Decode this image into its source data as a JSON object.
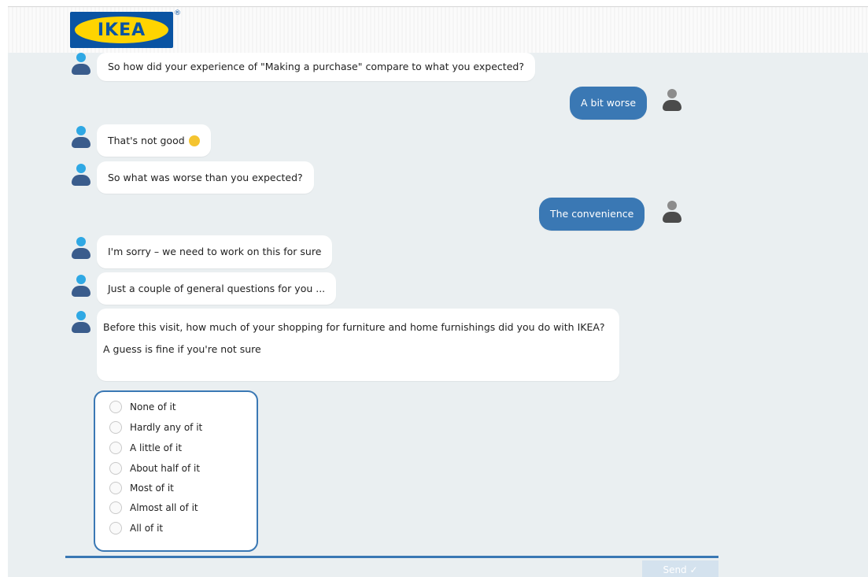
{
  "header": {
    "logo_text": "IKEA",
    "logo_mark": "®"
  },
  "messages": [
    {
      "from": "bot",
      "text": "So how did your experience of \"Making a purchase\" compare to what you expected?"
    },
    {
      "from": "user",
      "text": "A bit worse"
    },
    {
      "from": "bot",
      "text": "That's not good",
      "emoji": "grimacing-face-icon"
    },
    {
      "from": "bot",
      "text": "So what was worse than you expected?"
    },
    {
      "from": "user",
      "text": "The convenience"
    },
    {
      "from": "bot",
      "text": "I'm sorry – we need to work on this for sure"
    },
    {
      "from": "bot",
      "text": "Just a couple of general questions for you ..."
    },
    {
      "from": "bot",
      "text": "Before this visit, how much of your shopping for furniture and home furnishings did you do with IKEA?",
      "subtext": "A guess is fine if you're not sure"
    }
  ],
  "options": [
    "None of it",
    "Hardly any of it",
    "A little of it",
    "About half of it",
    "Most of it",
    "Almost all of it",
    "All of it"
  ],
  "composer": {
    "send_label": "Send ✓"
  },
  "colors": {
    "brand_blue": "#0a54a3",
    "brand_yellow": "#ffd400",
    "user_bubble": "#3a78b4",
    "chat_bg": "#eaeff1"
  }
}
